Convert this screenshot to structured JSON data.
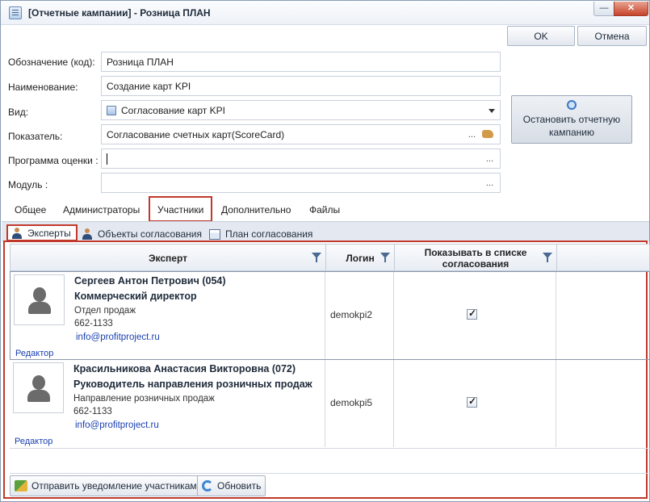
{
  "window": {
    "title": "[Отчетные кампании] - Розница ПЛАН",
    "minimize_label": "—",
    "close_label": "✕"
  },
  "buttons": {
    "ok": "OK",
    "cancel": "Отмена",
    "stop_campaign": "Остановить отчетную кампанию"
  },
  "form": {
    "code_label": "Обозначение (код):",
    "code_value": "Розница ПЛАН",
    "name_label": "Наименование:",
    "name_value": "Создание карт KPI",
    "type_label": "Вид:",
    "type_value": "Согласование карт KPI",
    "indicator_label": "Показатель:",
    "indicator_value": "Согласование счетных карт(ScoreCard)",
    "program_label": "Программа оценки :",
    "program_value": "",
    "module_label": "Модуль :",
    "module_value": "",
    "ellipsis": "..."
  },
  "tabs": [
    {
      "label": "Общее"
    },
    {
      "label": "Администраторы"
    },
    {
      "label": "Участники",
      "active": true
    },
    {
      "label": "Дополнительно"
    },
    {
      "label": "Файлы"
    }
  ],
  "subtabs": [
    {
      "label": "Эксперты",
      "active": true
    },
    {
      "label": "Объекты согласования"
    },
    {
      "label": "План согласования"
    }
  ],
  "grid": {
    "columns": [
      "Эксперт",
      "Логин",
      "Показывать в списке согласования"
    ],
    "rows": [
      {
        "name": "Сергеев Антон Петрович  (054)",
        "position": "Коммерческий директор",
        "department": "Отдел продаж",
        "phone": "662-1133",
        "email": "info@profitproject.ru",
        "editor_link": "Редактор",
        "login": "demokpi2",
        "show_in_list": true
      },
      {
        "name": "Красильникова Анастасия Викторовна  (072)",
        "position": "Руководитель направления розничных продаж",
        "department": "Направление розничных продаж",
        "phone": "662-1133",
        "email": "info@profitproject.ru",
        "editor_link": "Редактор",
        "login": "demokpi5",
        "show_in_list": true
      }
    ]
  },
  "footer": {
    "notify_button": "Отправить уведомление участникам",
    "refresh_button": "Обновить"
  }
}
